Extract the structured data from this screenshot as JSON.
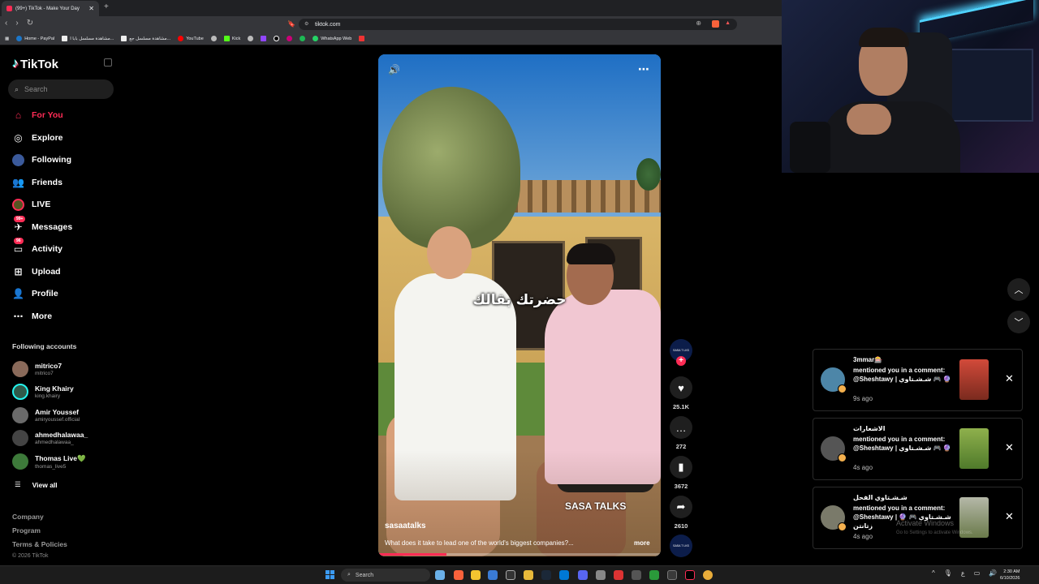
{
  "browser": {
    "tab_title": "(99+) TikTok - Make Your Day",
    "new_tab": "+",
    "url": "tiktok.com",
    "bookmarks": [
      "Home - PayPal",
      "مشاهدة مسلسل بابا ا...",
      "مشاهدة مسلسل جع...",
      "YouTube",
      "",
      "Kick",
      "",
      "",
      "",
      "",
      "",
      "WhatsApp Web",
      ""
    ]
  },
  "sidebar": {
    "logo": "TikTok",
    "search_placeholder": "Search",
    "nav": [
      {
        "label": "For You",
        "icon": "home-icon",
        "active": true
      },
      {
        "label": "Explore",
        "icon": "compass-icon"
      },
      {
        "label": "Following",
        "icon": "following-icon"
      },
      {
        "label": "Friends",
        "icon": "friends-icon"
      },
      {
        "label": "LIVE",
        "icon": "live-icon"
      },
      {
        "label": "Messages",
        "icon": "messages-icon",
        "badge": "99+"
      },
      {
        "label": "Activity",
        "icon": "activity-icon",
        "badge": "96"
      },
      {
        "label": "Upload",
        "icon": "upload-icon"
      },
      {
        "label": "Profile",
        "icon": "profile-icon"
      },
      {
        "label": "More",
        "icon": "more-icon"
      }
    ],
    "following_title": "Following accounts",
    "accounts": [
      {
        "name": "mitrico7",
        "handle": "mitrico7"
      },
      {
        "name": "King Khairy",
        "handle": "king.khairy"
      },
      {
        "name": "Amir Youssef",
        "handle": "amiryoussef.official"
      },
      {
        "name": "ahmedhalawaa_",
        "handle": "ahmedhalawaa_"
      },
      {
        "name": "Thomas Live💚",
        "handle": "thomas_live5"
      }
    ],
    "view_all": "View all",
    "footer": [
      "Company",
      "Program",
      "Terms & Policies"
    ],
    "copyright": "© 2026 TikTok"
  },
  "video": {
    "caption": "حضرتك بقالك",
    "watermark": "SASA TALKS",
    "author": "sasaatalks",
    "description": "What does it take to lead one of the world's biggest companies?...",
    "more": "more",
    "progress": 0.24
  },
  "actions": {
    "avatar_text": "SASA T LKS",
    "likes": "25.1K",
    "comments": "272",
    "saves": "3672",
    "shares": "2610"
  },
  "notifications": [
    {
      "title": "3mmar🎰",
      "text": "mentioned you in a comment: @Sheshtawy | شـشـتاوي 🎮 🔮",
      "ago": "9s ago"
    },
    {
      "title": "الاشعارات",
      "text": "mentioned you in a comment: @Sheshtawy | شـشـتاوي 🎮 🔮",
      "ago": "4s ago"
    },
    {
      "title": "شـشـتاوي الفحل",
      "text": "mentioned you in a comment: @Sheshtawy | شـشـتاوي 🎮 🔮 زتانتن",
      "ago": "4s ago"
    }
  ],
  "system": {
    "activate": "Activate Windows",
    "activate_sub": "Go to Settings to activate Windows.",
    "taskbar_search": "Search",
    "time": "2:30 AM",
    "date": "6/10/2026"
  },
  "colors": {
    "accent": "#fe2c55",
    "cyan": "#25f4ee"
  }
}
